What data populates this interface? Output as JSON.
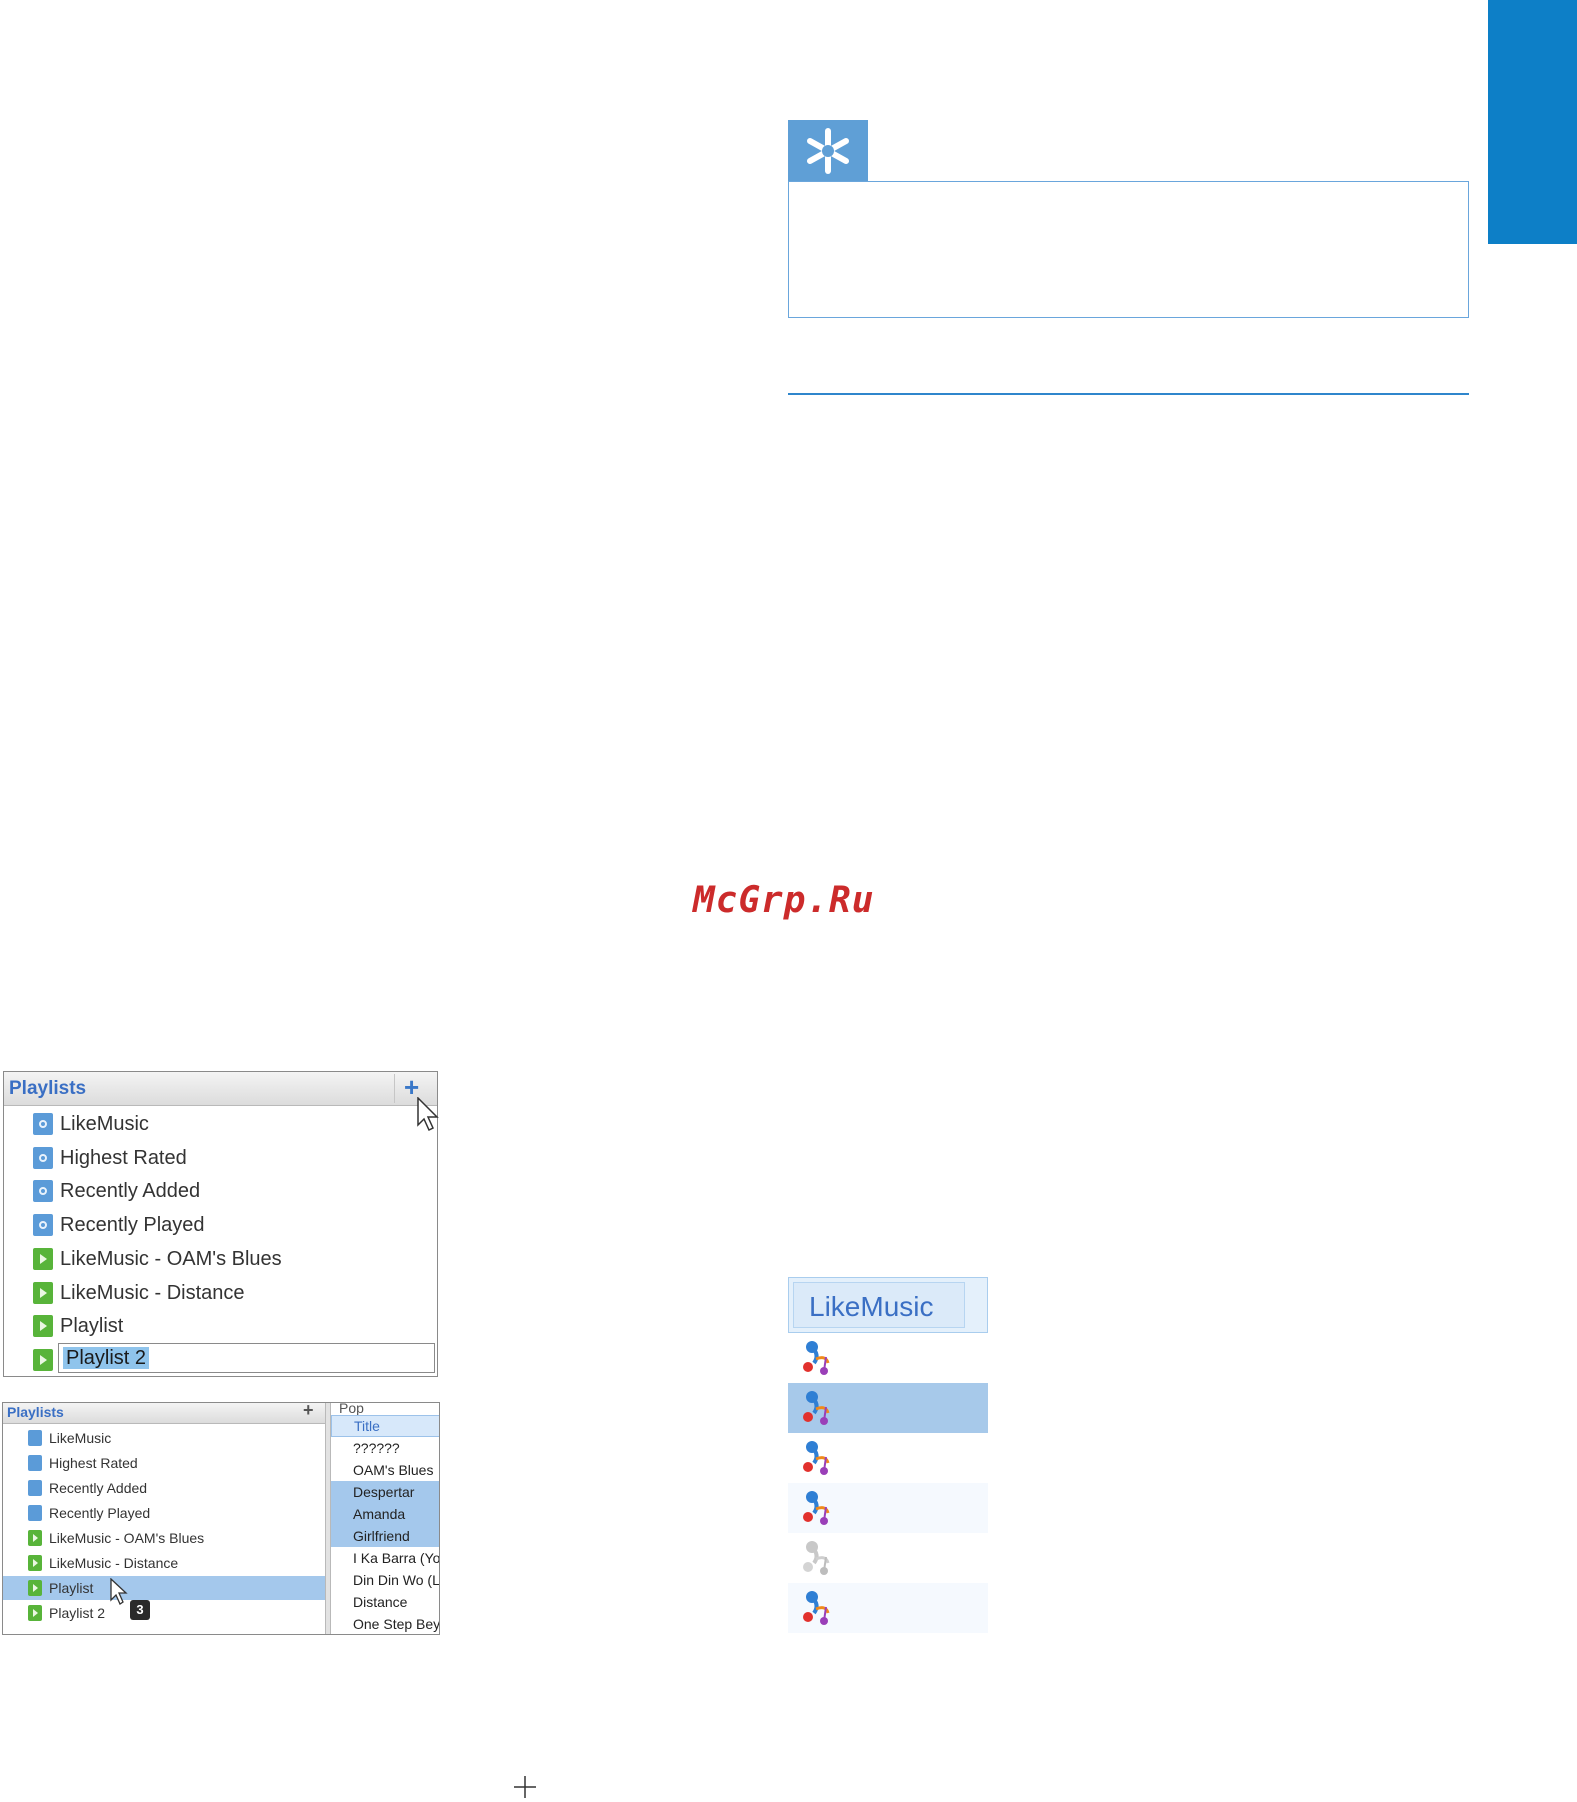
{
  "page": {
    "watermark": "McGrp.Ru",
    "accent_color": "#0d7fc7",
    "tip_icon": "asterisk-icon"
  },
  "playlists_panel_1": {
    "title": "Playlists",
    "add_button": "+",
    "items": [
      {
        "label": "LikeMusic",
        "icon": "smart-playlist-icon"
      },
      {
        "label": "Highest Rated",
        "icon": "auto-playlist-icon"
      },
      {
        "label": "Recently Added",
        "icon": "auto-playlist-icon"
      },
      {
        "label": "Recently Played",
        "icon": "auto-playlist-icon"
      },
      {
        "label": "LikeMusic - OAM's Blues",
        "icon": "playlist-icon"
      },
      {
        "label": "LikeMusic - Distance",
        "icon": "playlist-icon"
      },
      {
        "label": "Playlist",
        "icon": "playlist-icon"
      }
    ],
    "editing_item": "Playlist 2"
  },
  "playlists_panel_2": {
    "title": "Playlists",
    "add_button": "+",
    "items": [
      {
        "label": "LikeMusic"
      },
      {
        "label": "Highest Rated"
      },
      {
        "label": "Recently Added"
      },
      {
        "label": "Recently Played"
      },
      {
        "label": "LikeMusic - OAM's Blues"
      },
      {
        "label": "LikeMusic - Distance"
      },
      {
        "label": "Playlist",
        "selected": true
      },
      {
        "label": "Playlist 2"
      }
    ],
    "drag_count": "3",
    "column_partial_header": "Pop",
    "title_header": "Title",
    "tracks": [
      "??????",
      "OAM's Blues",
      "Despertar",
      "Amanda",
      "Girlfriend",
      "I Ka Barra (Yo",
      "Din Din Wo (L",
      "Distance",
      "One Step Bey"
    ]
  },
  "likemusic_column": {
    "header": "LikeMusic"
  }
}
